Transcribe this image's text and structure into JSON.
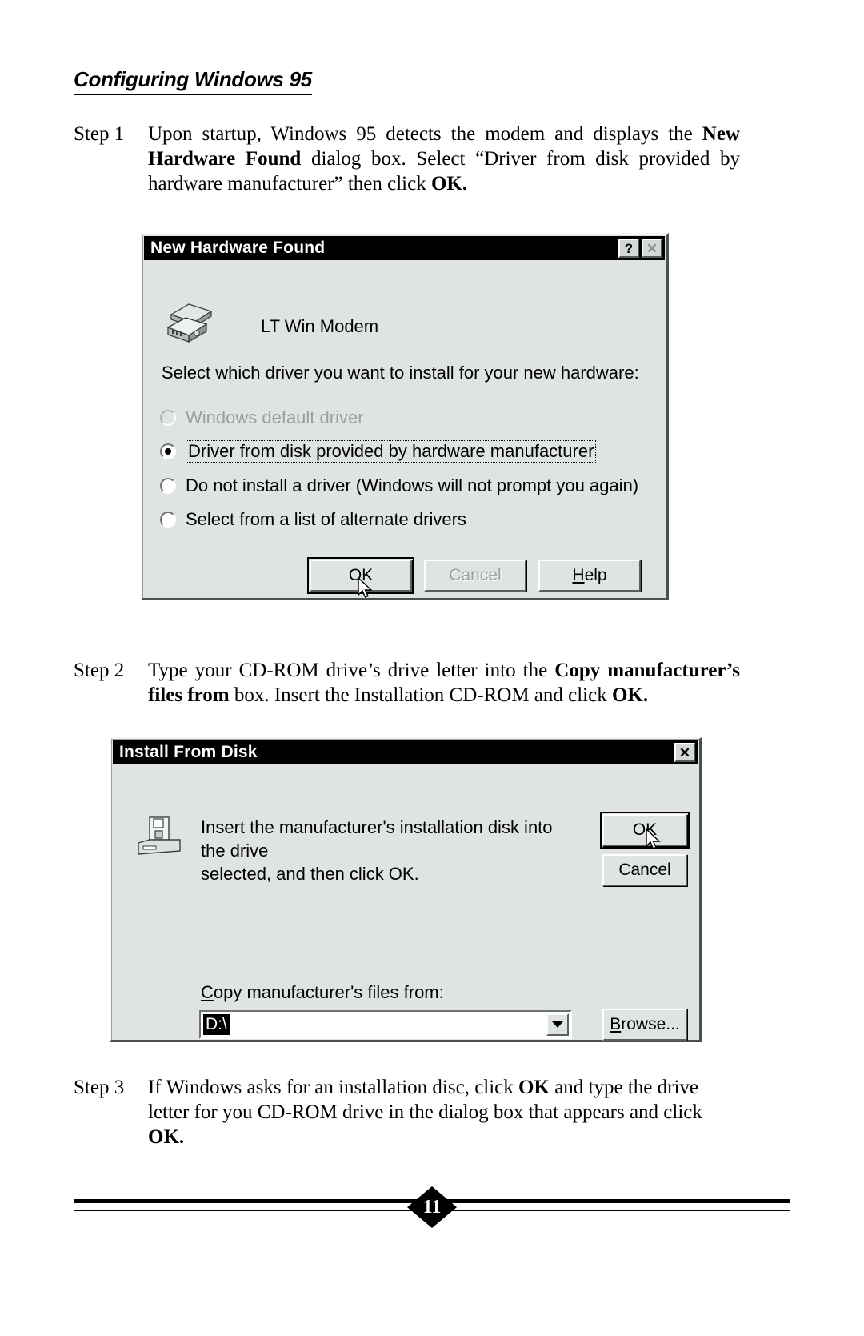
{
  "document": {
    "section_heading": "Configuring Windows 95",
    "steps": [
      {
        "label": "Step 1",
        "text_parts": [
          {
            "t": "Upon startup, Windows 95 detects the modem and displays the ",
            "b": false
          },
          {
            "t": "New Hardware Found",
            "b": true
          },
          {
            "t": " dialog box. Select “Driver from disk provided by hardware manufacturer” then click ",
            "b": false
          },
          {
            "t": "OK.",
            "b": true
          }
        ],
        "plain": "Upon startup, Windows 95 detects the modem and displays the New Hardware Found dialog box. Select “Driver from disk provided by hardware manufacturer” then click OK."
      },
      {
        "label": "Step 2",
        "plain": "Type your CD-ROM drive’s drive letter into the Copy manufacturer’s files from box. Insert the Installation CD-ROM and click OK."
      },
      {
        "label": "Step 3",
        "plain": "If Windows asks for an installation disc, click OK and type the drive letter for you CD-ROM drive in the dialog box that appears and click OK."
      }
    ],
    "page_number": "11"
  },
  "step1_text": {
    "p1": "Upon startup, Windows 95 detects the modem and displays the ",
    "p2": "New Hardware Found",
    "p3": " dialog box. Select “Driver from disk provided by hardware manufacturer” then click ",
    "p4": "OK."
  },
  "step2_text": {
    "p1": "Type your CD-ROM drive’s drive letter into the ",
    "p2": "Copy manufacturer’s files from",
    "p3": " box. Insert the Installation CD-ROM and click ",
    "p4": "OK."
  },
  "step3_text": {
    "p1": "If Windows asks for an installation disc, click ",
    "p2": "OK",
    "p3": " and type the drive letter for you CD-ROM drive in the dialog box that appears and click ",
    "p4": "OK."
  },
  "dialog_new_hardware": {
    "title": "New Hardware Found",
    "help_button": "?",
    "close_button": "✕",
    "device_name": "LT Win Modem",
    "prompt": "Select which driver you want to install for your new hardware:",
    "options": [
      {
        "label": "Windows default driver",
        "checked": false,
        "disabled": true,
        "focused": false
      },
      {
        "label": "Driver from disk provided by hardware manufacturer",
        "checked": true,
        "disabled": false,
        "focused": true
      },
      {
        "label": "Do not install a driver (Windows will not prompt you again)",
        "checked": false,
        "disabled": false,
        "focused": false
      },
      {
        "label": "Select from a list of alternate drivers",
        "checked": false,
        "disabled": false,
        "focused": false
      }
    ],
    "buttons": {
      "ok": "OK",
      "cancel": "Cancel",
      "help": "Help"
    }
  },
  "dialog_install_from_disk": {
    "title": "Install From Disk",
    "close_button": "✕",
    "message_line1": "Insert the manufacturer's installation disk into the drive",
    "message_line2": "selected, and then click OK.",
    "copy_from_label": "Copy manufacturer's files from:",
    "path_value": "D:\\",
    "buttons": {
      "ok": "OK",
      "cancel": "Cancel",
      "browse": "Browse..."
    }
  },
  "colors": {
    "dialog_face": "#dfe3e3",
    "titlebar": "#000000",
    "titlebar_text": "#ffffff",
    "disabled_text": "#9aa0a0",
    "field_bg": "#ffffff",
    "selection_bg": "#000000"
  }
}
